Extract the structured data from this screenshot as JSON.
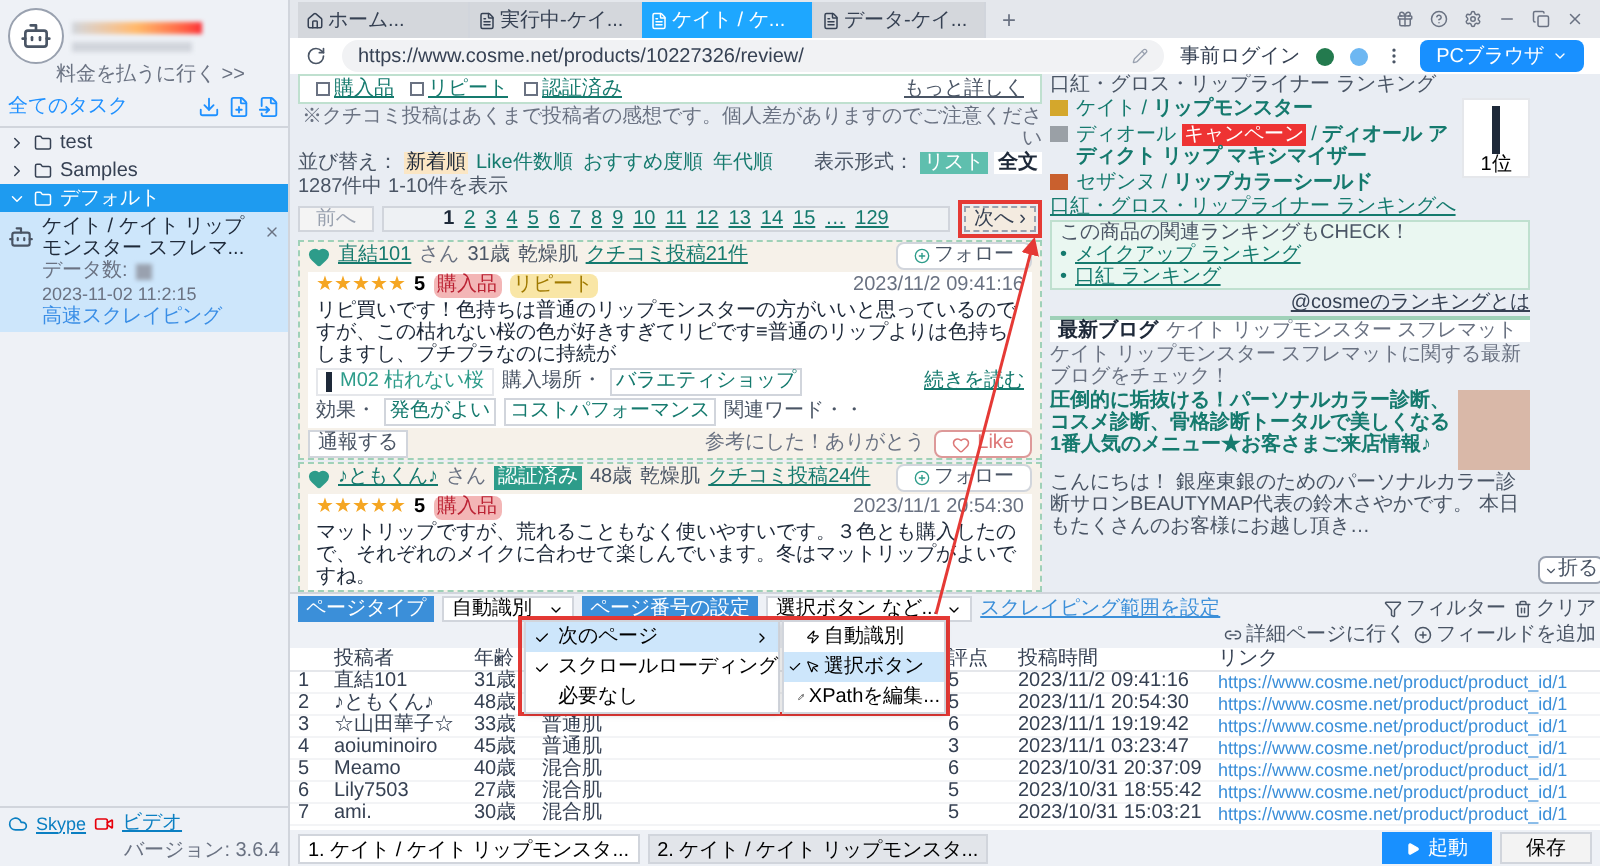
{
  "sidebar": {
    "pay_link": "料金を払うに行く >>",
    "header": "全てのタスク",
    "tree": [
      {
        "label": "test",
        "expanded": false,
        "selected": false
      },
      {
        "label": "Samples",
        "expanded": false,
        "selected": false
      },
      {
        "label": "デフォルト",
        "expanded": true,
        "selected": true,
        "children": [
          {
            "title": "ケイト / ケイト リップモンスター スフレマ...",
            "data_label": "データ数:",
            "date": "2023-11-02 11:2:15",
            "mode": "高速スクレイピング"
          }
        ]
      }
    ],
    "footer": {
      "skype": "Skype",
      "video": "ビデオ",
      "version": "バージョン: 3.6.4"
    }
  },
  "browser": {
    "tabs": [
      {
        "label": "ホーム...",
        "kind": "home",
        "selected": false
      },
      {
        "label": "実行中-ケイ...",
        "kind": "page",
        "selected": false
      },
      {
        "label": "ケイト / ケ...",
        "kind": "page",
        "selected": true
      },
      {
        "label": "データ-ケイ...",
        "kind": "page",
        "selected": false
      }
    ],
    "new_tab": "+",
    "url": "https://www.cosme.net/products/10227326/review/",
    "login": "事前ログイン",
    "mode_button": "PCブラウザ"
  },
  "page": {
    "filters": [
      {
        "label": "購入品",
        "checked": false
      },
      {
        "label": "リピート",
        "checked": false
      },
      {
        "label": "認証済み",
        "checked": false
      }
    ],
    "more": "もっと詳しく",
    "notice": "※クチコミ投稿はあくまで投稿者の感想です。個人差がありますのでご注意ください",
    "sort_label": "並び替え：",
    "sort": [
      {
        "label": "新着順",
        "selected": true
      },
      {
        "label": "Like件数順",
        "selected": false
      },
      {
        "label": "おすすめ度順",
        "selected": false
      },
      {
        "label": "年代順",
        "selected": false
      }
    ],
    "view_label": "表示形式：",
    "views": [
      {
        "label": "リスト",
        "selected": true
      },
      {
        "label": "全文",
        "selected": false
      }
    ],
    "count": "1287件中 1-10件を表示",
    "prev": "前へ",
    "pages": [
      {
        "label": "1",
        "selected": true
      },
      {
        "label": "2",
        "selected": false
      },
      {
        "label": "3",
        "selected": false
      },
      {
        "label": "4",
        "selected": false
      },
      {
        "label": "5",
        "selected": false
      },
      {
        "label": "6",
        "selected": false
      },
      {
        "label": "7",
        "selected": false
      },
      {
        "label": "8",
        "selected": false
      },
      {
        "label": "9",
        "selected": false
      },
      {
        "label": "10",
        "selected": false
      },
      {
        "label": "11",
        "selected": false
      },
      {
        "label": "12",
        "selected": false
      },
      {
        "label": "13",
        "selected": false
      },
      {
        "label": "14",
        "selected": false
      },
      {
        "label": "15",
        "selected": false
      },
      {
        "label": "…",
        "selected": false
      },
      {
        "label": "129",
        "selected": false
      }
    ],
    "next": "次へ ›",
    "reviews": [
      {
        "name": "直結101",
        "san": "さん",
        "age": "31歳",
        "skin": "乾燥肌",
        "posts": "クチコミ投稿21件",
        "follow": "フォロー",
        "stars": 5,
        "score": "5",
        "badges": [
          "購入品",
          "リピート"
        ],
        "date": "2023/11/2 09:41:16",
        "text": "リピ買いです！色持ちは普通のリップモンスターの方がいいと思っているのですが、この枯れない桜の色が好きすぎてリピです≡普通のリップよりは色持ちしますし、プチプラなのに持続が",
        "read_more": "続きを読む",
        "product": "M02 枯れない桜",
        "tags_label_1": "購入場所・",
        "tags_1": [
          "バラエティショップ"
        ],
        "tags_label_2": "効果・",
        "tags_2": [
          "発色がよい",
          "コストパフォーマンス"
        ],
        "tags_label_3": "関連ワード・・",
        "report": "通報する",
        "thanks": "参考にした！ありがとう",
        "like": "Like"
      },
      {
        "name": "♪ともくん♪",
        "san": "さん",
        "verified": "認証済み",
        "age": "48歳",
        "skin": "乾燥肌",
        "posts": "クチコミ投稿24件",
        "follow": "フォロー",
        "stars": 5,
        "score": "5",
        "badges": [
          "購入品"
        ],
        "date": "2023/11/1 20:54:30",
        "text": "マットリップですが、荒れることもなく使いやすいです。３色とも購入したので、それぞれのメイクに合わせて楽しんでいます。冬はマットリップがよいですね。"
      }
    ],
    "ranking": {
      "subtitle": "口紅・グロス・リップライナー ランキング",
      "items": [
        {
          "brand": "ケイト",
          "separator": "/",
          "product": "リップモンスター"
        },
        {
          "brand": "ディオール",
          "badge": "キャンペーン",
          "separator": "/",
          "product": "ディオール アディクト リップ マキシマイザー"
        },
        {
          "brand": "セザンヌ",
          "separator": "/",
          "product": "リップカラーシールド"
        }
      ],
      "rank_label": "1位",
      "link": "口紅・グロス・リップライナー ランキングへ",
      "check_title": "この商品の関連ランキングもCHECK！",
      "check_links": [
        {
          "bullet": "•",
          "label": "メイクアップ ランキング"
        },
        {
          "bullet": "•",
          "label": "口紅 ランキング"
        }
      ],
      "about": "@cosmeのランキングとは"
    },
    "blog": {
      "title": "最新ブログ",
      "subtitle": "ケイト リップモンスター スフレマット",
      "intro": "ケイト リップモンスター スフレマットに関する最新ブログをチェック！",
      "post_title": "圧倒的に垢抜ける！パーソナルカラー診断、コスメ診断、骨格診断トータルで美しくなる1番人気のメニュー★お客さまご来店情報♪",
      "post_text": "こんにちは！ 銀座東銀のためのパーソナルカラー診断サロンBEAUTYMAP代表の鈴木さやかです。 本日もたくさんのお客様にお越し頂き…"
    },
    "collapse": "折る"
  },
  "panel": {
    "page_type_label": "ページタイプ",
    "page_type": "自動識別",
    "page_number_label": "ページ番号の設定",
    "page_number": "選択ボタン など...",
    "range": "スクレイピング範囲を設定",
    "actions": [
      {
        "label": "フィルター",
        "kind": "filter"
      },
      {
        "label": "クリア",
        "kind": "clear"
      },
      {
        "label": "詳細ページに行く",
        "kind": "link"
      },
      {
        "label": "フィールドを追加",
        "kind": "add"
      }
    ],
    "menu": [
      {
        "label": "次のページ",
        "checked": true,
        "selected": true
      },
      {
        "label": "スクロールローディング",
        "checked": true,
        "selected": false
      },
      {
        "label": "必要なし",
        "checked": false,
        "selected": false
      }
    ],
    "submenu": [
      {
        "label": "自動識別",
        "kind": "auto",
        "checked": false,
        "selected": false
      },
      {
        "label": "選択ボタン",
        "kind": "click",
        "checked": true,
        "selected": true
      },
      {
        "label": "XPathを編集...",
        "kind": "edit",
        "checked": false,
        "selected": false
      }
    ],
    "table": {
      "columns": [
        "",
        "投稿者",
        "年齢",
        "",
        "評点",
        "投稿時間",
        "リンク"
      ],
      "rows": [
        [
          "1",
          "直結101",
          "31歳",
          "",
          "5",
          "2023/11/2 09:41:16",
          "https://www.cosme.net/product/product_id/1"
        ],
        [
          "2",
          "♪ともくん♪",
          "48歳",
          "",
          "5",
          "2023/11/1 20:54:30",
          "https://www.cosme.net/product/product_id/1"
        ],
        [
          "3",
          "☆山田華子☆",
          "33歳",
          "普通肌",
          "6",
          "2023/11/1 19:19:42",
          "https://www.cosme.net/product/product_id/1"
        ],
        [
          "4",
          "aoiuminoiro",
          "45歳",
          "普通肌",
          "3",
          "2023/11/1 03:23:47",
          "https://www.cosme.net/product/product_id/1"
        ],
        [
          "5",
          "Meamo",
          "40歳",
          "混合肌",
          "6",
          "2023/10/31 20:37:09",
          "https://www.cosme.net/product/product_id/1"
        ],
        [
          "6",
          "Lily7503",
          "27歳",
          "混合肌",
          "5",
          "2023/10/31 18:55:42",
          "https://www.cosme.net/product/product_id/1"
        ],
        [
          "7",
          "ami.",
          "30歳",
          "混合肌",
          "5",
          "2023/10/31 15:03:21",
          "https://www.cosme.net/product/product_id/1"
        ]
      ]
    },
    "sheets": [
      {
        "label": "1. ケイト / ケイト リップモンスタ...",
        "selected": true
      },
      {
        "label": "2. ケイト / ケイト リップモンスタ...",
        "selected": false
      }
    ],
    "start": "起動",
    "save": "保存"
  }
}
